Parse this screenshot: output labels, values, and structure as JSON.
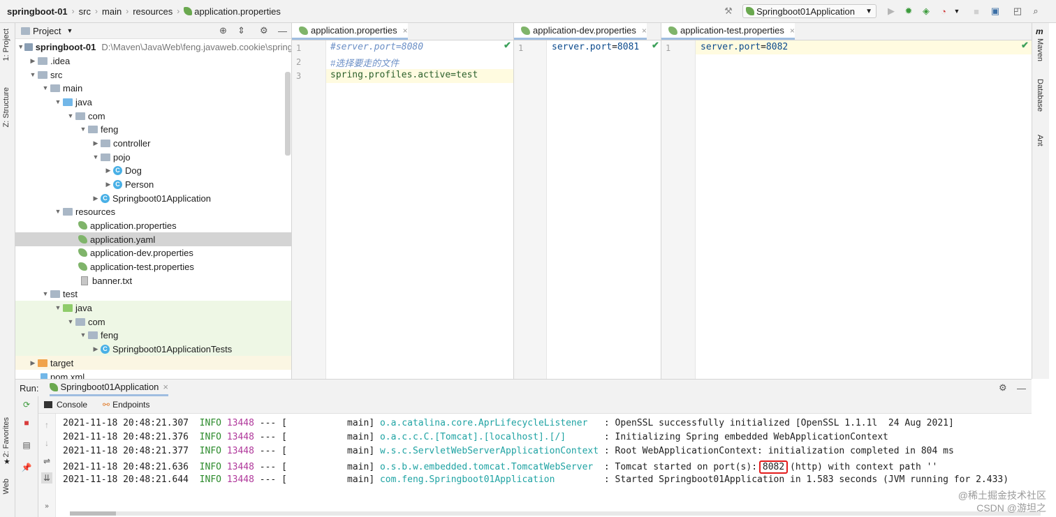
{
  "breadcrumb": {
    "project": "springboot-01",
    "parts": [
      "src",
      "main",
      "resources",
      "application.properties"
    ]
  },
  "toolbar": {
    "run_config": "Springboot01Application"
  },
  "left_tabs": {
    "project": "1: Project",
    "structure": "Z: Structure",
    "favorites": "2: Favorites",
    "web": "Web"
  },
  "right_tabs": {
    "maven": "Maven",
    "database": "Database",
    "ant": "Ant"
  },
  "project_panel": {
    "title": "Project",
    "root_name": "springboot-01",
    "root_path": "D:\\Maven\\JavaWeb\\feng.javaweb.cookie\\spring",
    "items": [
      {
        "label": ".idea"
      },
      {
        "label": "src"
      },
      {
        "label": "main"
      },
      {
        "label": "java"
      },
      {
        "label": "com"
      },
      {
        "label": "feng"
      },
      {
        "label": "controller"
      },
      {
        "label": "pojo"
      },
      {
        "label": "Dog"
      },
      {
        "label": "Person"
      },
      {
        "label": "Springboot01Application"
      },
      {
        "label": "resources"
      },
      {
        "label": "application.properties"
      },
      {
        "label": "application.yaml"
      },
      {
        "label": "application-dev.properties"
      },
      {
        "label": "application-test.properties"
      },
      {
        "label": "banner.txt"
      },
      {
        "label": "test"
      },
      {
        "label": "java"
      },
      {
        "label": "com"
      },
      {
        "label": "feng"
      },
      {
        "label": "Springboot01ApplicationTests"
      },
      {
        "label": "target"
      },
      {
        "label": "pom.xml"
      }
    ]
  },
  "editors": [
    {
      "tab": "application.properties",
      "lines": [
        {
          "num": "1",
          "text": "#server.port=8080"
        },
        {
          "num": "2",
          "text": "#选择要走的文件"
        },
        {
          "num": "3",
          "text": "spring.profiles.active=test"
        }
      ]
    },
    {
      "tab": "application-dev.properties",
      "lines": [
        {
          "num": "1",
          "key": "server.port",
          "eq": "=",
          "value": "8081"
        }
      ]
    },
    {
      "tab": "application-test.properties",
      "lines": [
        {
          "num": "1",
          "key": "server.port",
          "eq": "=",
          "value": "8082"
        }
      ]
    }
  ],
  "run_panel": {
    "label": "Run:",
    "config_tab": "Springboot01Application",
    "console_tab": "Console",
    "endpoints_tab": "Endpoints",
    "log": [
      {
        "ts": "2021-11-18 20:48:21.307",
        "level": "INFO",
        "pid": "13448",
        "sep": "--- [",
        "thread": "main]",
        "logger": "o.a.catalina.core.AprLifecycleListener",
        "msg": ": OpenSSL successfully initialized [OpenSSL 1.1.1l  24 Aug 2021]"
      },
      {
        "ts": "2021-11-18 20:48:21.376",
        "level": "INFO",
        "pid": "13448",
        "sep": "--- [",
        "thread": "main]",
        "logger": "o.a.c.c.C.[Tomcat].[localhost].[/]",
        "msg": ": Initializing Spring embedded WebApplicationContext"
      },
      {
        "ts": "2021-11-18 20:48:21.377",
        "level": "INFO",
        "pid": "13448",
        "sep": "--- [",
        "thread": "main]",
        "logger": "w.s.c.ServletWebServerApplicationContext",
        "msg": ": Root WebApplicationContext: initialization completed in 804 ms"
      },
      {
        "ts": "2021-11-18 20:48:21.636",
        "level": "INFO",
        "pid": "13448",
        "sep": "--- [",
        "thread": "main]",
        "logger": "o.s.b.w.embedded.tomcat.TomcatWebServer",
        "msg_pre": ": Tomcat started on port(s): ",
        "port": "8082",
        "msg_post": " (http) with context path ''"
      },
      {
        "ts": "2021-11-18 20:48:21.644",
        "level": "INFO",
        "pid": "13448",
        "sep": "--- [",
        "thread": "main]",
        "logger": "com.feng.Springboot01Application",
        "msg": ": Started Springboot01Application in 1.583 seconds (JVM running for 2.433)"
      }
    ]
  },
  "watermark": {
    "line1": "@稀土掘金技术社区",
    "line2": "CSDN @游坦之"
  }
}
